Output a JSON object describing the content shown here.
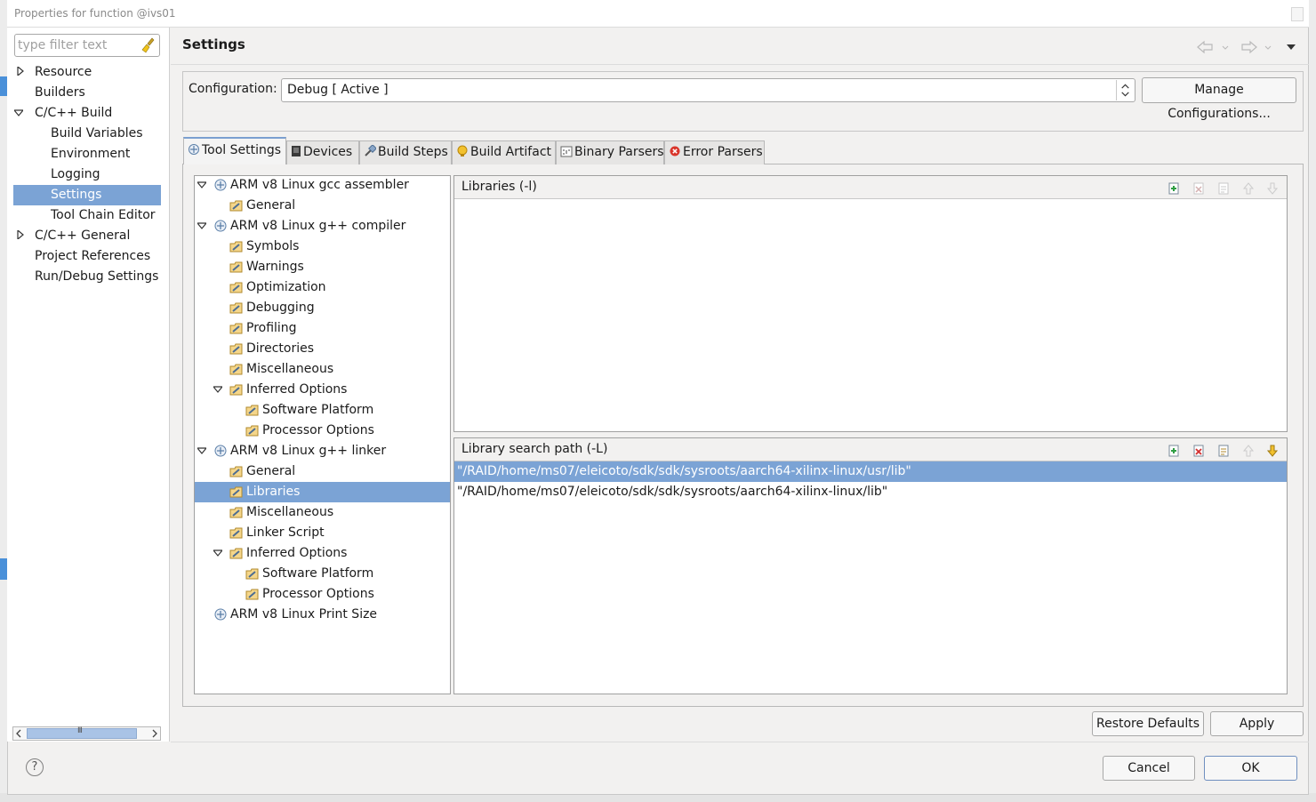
{
  "window": {
    "title": "Properties for function @ivs01"
  },
  "filter": {
    "placeholder": "type filter text"
  },
  "nav": {
    "items": [
      {
        "label": "Resource"
      },
      {
        "label": "Builders"
      },
      {
        "label": "C/C++ Build"
      },
      {
        "label": "Build Variables"
      },
      {
        "label": "Environment"
      },
      {
        "label": "Logging"
      },
      {
        "label": "Settings"
      },
      {
        "label": "Tool Chain Editor"
      },
      {
        "label": "C/C++ General"
      },
      {
        "label": "Project References"
      },
      {
        "label": "Run/Debug Settings"
      }
    ],
    "selected": "Settings"
  },
  "page": {
    "title": "Settings"
  },
  "config": {
    "label": "Configuration:",
    "value": "Debug  [ Active ]",
    "manage_label": "Manage Configurations..."
  },
  "tabs": [
    {
      "label": "Tool Settings",
      "icon": "tool-settings-icon"
    },
    {
      "label": "Devices",
      "icon": "device-icon"
    },
    {
      "label": "Build Steps",
      "icon": "build-steps-icon"
    },
    {
      "label": "Build Artifact",
      "icon": "build-artifact-icon"
    },
    {
      "label": "Binary Parsers",
      "icon": "binary-parsers-icon"
    },
    {
      "label": "Error Parsers",
      "icon": "error-parsers-icon"
    }
  ],
  "tree": {
    "items": [
      {
        "label": "ARM v8 Linux gcc assembler"
      },
      {
        "label": "General"
      },
      {
        "label": "ARM v8 Linux g++ compiler"
      },
      {
        "label": "Symbols"
      },
      {
        "label": "Warnings"
      },
      {
        "label": "Optimization"
      },
      {
        "label": "Debugging"
      },
      {
        "label": "Profiling"
      },
      {
        "label": "Directories"
      },
      {
        "label": "Miscellaneous"
      },
      {
        "label": "Inferred Options"
      },
      {
        "label": "Software Platform"
      },
      {
        "label": "Processor Options"
      },
      {
        "label": "ARM v8 Linux g++ linker"
      },
      {
        "label": "General"
      },
      {
        "label": "Libraries"
      },
      {
        "label": "Miscellaneous"
      },
      {
        "label": "Linker Script"
      },
      {
        "label": "Inferred Options"
      },
      {
        "label": "Software Platform"
      },
      {
        "label": "Processor Options"
      },
      {
        "label": "ARM v8 Linux Print Size"
      }
    ],
    "selected": "Libraries"
  },
  "libraries": {
    "title": "Libraries (-l)",
    "items": []
  },
  "library_paths": {
    "title": "Library search path (-L)",
    "items": [
      "\"/RAID/home/ms07/eleicoto/sdk/sdk/sysroots/aarch64-xilinx-linux/usr/lib\"",
      "\"/RAID/home/ms07/eleicoto/sdk/sdk/sysroots/aarch64-xilinx-linux/lib\""
    ]
  },
  "buttons": {
    "restore": "Restore Defaults",
    "apply": "Apply",
    "cancel": "Cancel",
    "ok": "OK",
    "help": "?"
  }
}
